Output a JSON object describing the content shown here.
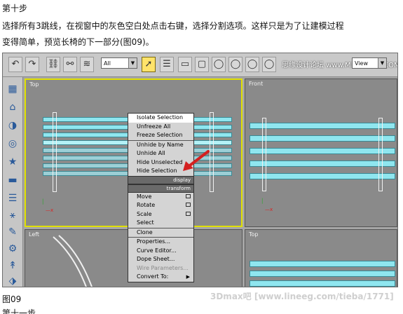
{
  "article": {
    "step_title": "第十步",
    "desc_line1": "选择所有3跳线，在视窗中的灰色空白处点击右键，选择分割选项。这样只是为了让建模过程",
    "desc_line2": "变得简单，预览长椅的下一部分(图09)。",
    "caption": "图09",
    "caption_next": "第十一步"
  },
  "toolbar": {
    "selection_filter": "All",
    "view_dropdown": "View",
    "watermark": "思缘设计论坛  www.MISSYUAN.COM"
  },
  "viewports": {
    "top_left": "Top",
    "top_right": "Front",
    "bottom_left": "Left",
    "bottom_right": "Top"
  },
  "context_menu": {
    "group1": [
      "Isolate Selection",
      "Unfreeze All",
      "Freeze Selection",
      "Unhide by Name",
      "Unhide All",
      "Hide Unselected",
      "Hide Selection"
    ],
    "section_display": "display",
    "section_transform": "transform",
    "group2": [
      "Move",
      "Rotate",
      "Scale",
      "Select",
      "Clone",
      "Properties...",
      "Curve Editor...",
      "Dope Sheet...",
      "Wire Parameters...",
      "Convert To:"
    ],
    "highlighted": "Isolate Selection",
    "disabled": "Wire Parameters..."
  },
  "watermark_bottom": "3Dmax吧  [www.lineeg.com/tieba/1771]",
  "colors": {
    "active_viewport_border": "#e0e000",
    "bench_slat": "#8fe6ef",
    "arrow": "#d42020"
  }
}
